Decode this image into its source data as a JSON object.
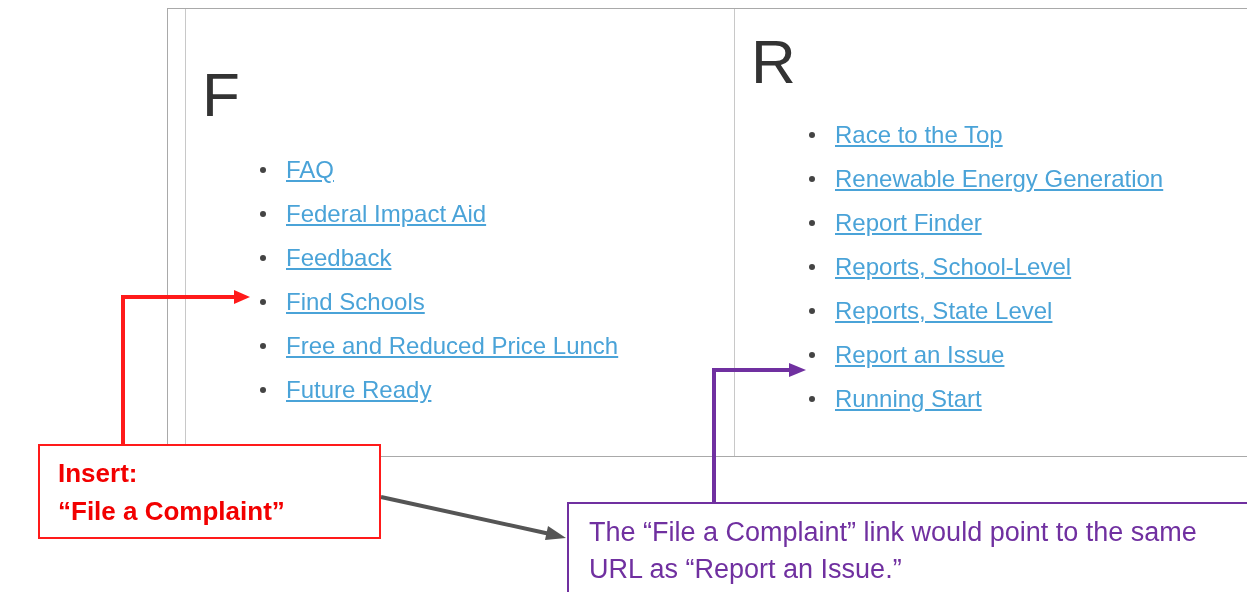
{
  "sections": [
    {
      "letter": "F",
      "links": [
        "FAQ",
        "Federal Impact Aid",
        "Feedback",
        "Find Schools",
        "Free and Reduced Price Lunch",
        "Future Ready"
      ]
    },
    {
      "letter": "R",
      "links": [
        "Race to the Top",
        "Renewable Energy Generation",
        "Report Finder",
        "Reports, School-Level",
        "Reports, State Level",
        "Report an Issue",
        "Running Start"
      ]
    }
  ],
  "annotations": {
    "insert_note": {
      "lines": [
        "Insert:",
        "“File a Complaint”"
      ]
    },
    "url_note": {
      "text": "The “File a Complaint” link would point to the same URL as “Report an Issue.”"
    }
  }
}
